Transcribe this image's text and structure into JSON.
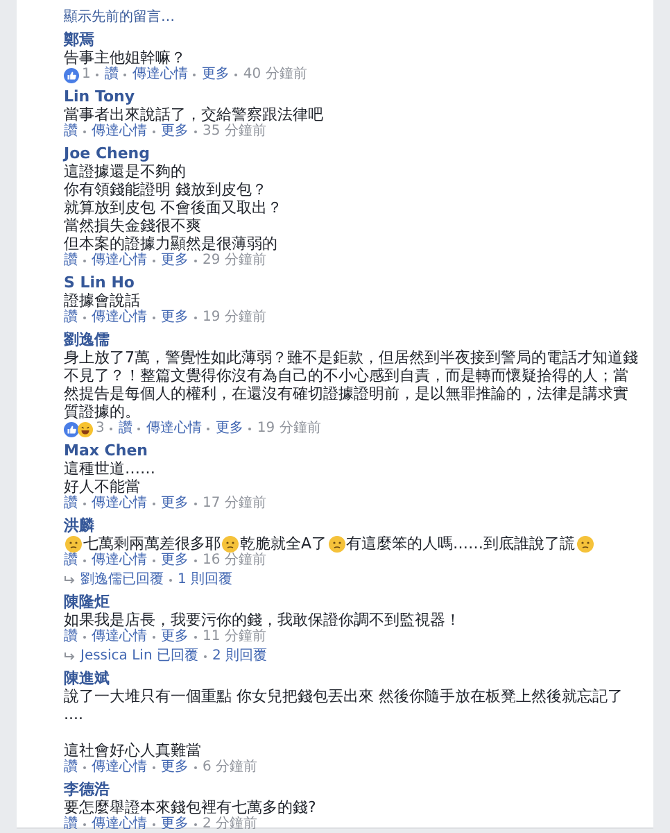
{
  "previous_link": "顯示先前的留言…",
  "comments": [
    {
      "author": "鄭焉",
      "paragraphs": [
        [
          {
            "kind": "text",
            "text": "告事主他姐幹嘛？"
          }
        ]
      ],
      "reactions": {
        "icons": [
          {
            "kind": "like"
          }
        ],
        "count": "1"
      },
      "actions": [
        "讚",
        "傳達心情",
        "更多"
      ],
      "time": "40 分鐘前"
    },
    {
      "author": "Lin Tony",
      "paragraphs": [
        [
          {
            "kind": "text",
            "text": "當事者出來說話了，交給警察跟法律吧"
          }
        ]
      ],
      "actions": [
        "讚",
        "傳達心情",
        "更多"
      ],
      "time": "35 分鐘前"
    },
    {
      "author": "Joe Cheng",
      "paragraphs": [
        [
          {
            "kind": "text",
            "text": "這證據還是不夠的"
          }
        ],
        [
          {
            "kind": "text",
            "text": "你有領錢能證明 錢放到皮包？"
          }
        ],
        [
          {
            "kind": "text",
            "text": "就算放到皮包 不會後面又取出？"
          }
        ],
        [
          {
            "kind": "text",
            "text": "當然損失金錢很不爽"
          }
        ],
        [
          {
            "kind": "text",
            "text": "但本案的證據力顯然是很薄弱的"
          }
        ]
      ],
      "actions": [
        "讚",
        "傳達心情",
        "更多"
      ],
      "time": "29 分鐘前"
    },
    {
      "author": "S Lin Ho",
      "paragraphs": [
        [
          {
            "kind": "text",
            "text": "證據會說話"
          }
        ]
      ],
      "actions": [
        "讚",
        "傳達心情",
        "更多"
      ],
      "time": "19 分鐘前"
    },
    {
      "author": "劉逸儒",
      "paragraphs": [
        [
          {
            "kind": "text",
            "text": "身上放了7萬，警覺性如此薄弱？雖不是鉅款，但居然到半夜接到警局的電話才知道錢不見了？！整篇文覺得你沒有為自己的不小心感到自責，而是轉而懷疑拾得的人；當然提告是每個人的權利，在還沒有確切證據證明前，是以無罪推論的，法律是講求實質證據的。"
          }
        ]
      ],
      "reactions": {
        "icons": [
          {
            "kind": "like"
          },
          {
            "kind": "haha"
          }
        ],
        "count": "3"
      },
      "actions": [
        "讚",
        "傳達心情",
        "更多"
      ],
      "time": "19 分鐘前"
    },
    {
      "author": "Max Chen",
      "paragraphs": [
        [
          {
            "kind": "text",
            "text": "這種世道……"
          }
        ],
        [
          {
            "kind": "text",
            "text": "好人不能當"
          }
        ]
      ],
      "actions": [
        "讚",
        "傳達心情",
        "更多"
      ],
      "time": "17 分鐘前"
    },
    {
      "author": "洪麟",
      "paragraphs": [
        [
          {
            "kind": "emoji"
          },
          {
            "kind": "text",
            "text": "七萬剩兩萬差很多耶"
          },
          {
            "kind": "emoji"
          },
          {
            "kind": "text",
            "text": "乾脆就全A了"
          },
          {
            "kind": "emoji"
          },
          {
            "kind": "text",
            "text": "有這麼笨的人嗎……到底誰說了謊"
          },
          {
            "kind": "emoji"
          }
        ]
      ],
      "actions": [
        "讚",
        "傳達心情",
        "更多"
      ],
      "time": "16 分鐘前",
      "replies": {
        "who": "劉逸儒已回覆",
        "count": "1 則回覆"
      }
    },
    {
      "author": "陳隆炬",
      "paragraphs": [
        [
          {
            "kind": "text",
            "text": "如果我是店長，我要污你的錢，我敢保證你調不到監視器！"
          }
        ]
      ],
      "actions": [
        "讚",
        "傳達心情",
        "更多"
      ],
      "time": "11 分鐘前",
      "replies": {
        "who": "Jessica Lin 已回覆",
        "count": "2 則回覆"
      }
    },
    {
      "author": "陳進斌",
      "paragraphs": [
        [
          {
            "kind": "text",
            "text": "說了一大堆只有一個重點 你女兒把錢包丟出來 然後你隨手放在板凳上然後就忘記了 ...."
          }
        ],
        [
          {
            "kind": "gap"
          }
        ],
        [
          {
            "kind": "text",
            "text": "這社會好心人真難當"
          }
        ]
      ],
      "actions": [
        "讚",
        "傳達心情",
        "更多"
      ],
      "time": "6 分鐘前"
    },
    {
      "author": "李德浩",
      "paragraphs": [
        [
          {
            "kind": "text",
            "text": "要怎麼舉證本來錢包裡有七萬多的錢?"
          }
        ]
      ],
      "actions": [
        "讚",
        "傳達心情",
        "更多"
      ],
      "time": "2 分鐘前"
    }
  ]
}
